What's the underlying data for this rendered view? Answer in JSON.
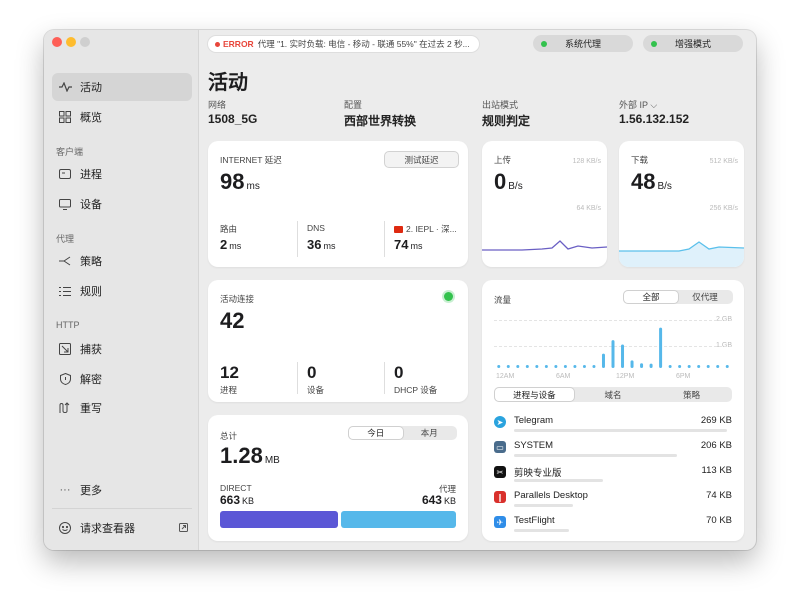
{
  "top": {
    "error_badge": "ERROR",
    "error_text": "代理 \"1. 实时负载: 电信 - 移动 - 联通 55%\" 在过去 2 秒...",
    "system_proxy": "系统代理",
    "enhanced_mode": "增强模式"
  },
  "sidebar": {
    "items": [
      {
        "label": "活动",
        "icon": "activity-icon"
      },
      {
        "label": "概览",
        "icon": "grid-icon"
      },
      {
        "label": "进程",
        "icon": "process-icon"
      },
      {
        "label": "设备",
        "icon": "monitor-icon"
      },
      {
        "label": "策略",
        "icon": "share-icon"
      },
      {
        "label": "规则",
        "icon": "list-icon"
      },
      {
        "label": "捕获",
        "icon": "capture-icon"
      },
      {
        "label": "解密",
        "icon": "shield-icon"
      },
      {
        "label": "重写",
        "icon": "rewrite-icon"
      },
      {
        "label": "更多",
        "icon": "more-icon"
      },
      {
        "label": "请求查看器",
        "icon": "viewer-icon"
      }
    ],
    "sections": {
      "client": "客户端",
      "proxy": "代理",
      "http": "HTTP"
    }
  },
  "page": {
    "title": "活动",
    "network_label": "网络",
    "network_value": "1508_5G",
    "profile_label": "配置",
    "profile_value": "西部世界转换",
    "outbound_label": "出站模式",
    "outbound_value": "规则判定",
    "ip_label": "外部 IP ⌵",
    "ip_value": "1.56.132.152"
  },
  "latency": {
    "title": "INTERNET 延迟",
    "test_button": "测试延迟",
    "value": "98",
    "unit": "ms",
    "router_label": "路由",
    "router_value": "2",
    "router_unit": "ms",
    "dns_label": "DNS",
    "dns_value": "36",
    "dns_unit": "ms",
    "proxy_label": "2. IEPL · 深...",
    "proxy_value": "74",
    "proxy_unit": "ms"
  },
  "upload": {
    "title": "上传",
    "value": "0",
    "unit": "B/s",
    "scale_top": "128 KB/s",
    "scale_mid": "64 KB/s"
  },
  "download": {
    "title": "下载",
    "value": "48",
    "unit": "B/s",
    "scale_top": "512 KB/s",
    "scale_mid": "256 KB/s"
  },
  "connections": {
    "title": "活动连接",
    "value": "42",
    "proc_value": "12",
    "proc_label": "进程",
    "dev_value": "0",
    "dev_label": "设备",
    "dhcp_value": "0",
    "dhcp_label": "DHCP 设备"
  },
  "total": {
    "title": "总计",
    "tab_today": "今日",
    "tab_month": "本月",
    "value": "1.28",
    "unit": "MB",
    "direct_label": "DIRECT",
    "direct_value": "663",
    "direct_unit": "KB",
    "proxy_label": "代理",
    "proxy_value": "643",
    "proxy_unit": "KB"
  },
  "traffic": {
    "title": "流量",
    "tab_all": "全部",
    "tab_proxy": "仅代理",
    "y_top": "2 GB",
    "y_mid": "1 GB",
    "x_labels": [
      "12AM",
      "6AM",
      "12PM",
      "6PM"
    ],
    "sub_tabs": [
      "进程与设备",
      "域名",
      "策略"
    ],
    "apps": [
      {
        "name": "Telegram",
        "value": "269 KB",
        "icon": "telegram-icon",
        "bar": 0.98
      },
      {
        "name": "SYSTEM",
        "value": "206 KB",
        "icon": "laptop-icon",
        "bar": 0.75
      },
      {
        "name": "剪映专业版",
        "value": "113 KB",
        "icon": "capcut-icon",
        "bar": 0.41
      },
      {
        "name": "Parallels Desktop",
        "value": "74 KB",
        "icon": "parallels-icon",
        "bar": 0.27
      },
      {
        "name": "TestFlight",
        "value": "70 KB",
        "icon": "testflight-icon",
        "bar": 0.25
      }
    ]
  },
  "colors": {
    "accent_blue": "#56b8ea",
    "direct_purple": "#5b57d6",
    "upload_line": "#6a5fc4",
    "download_line": "#5bc0eb",
    "green": "#33c24d"
  }
}
